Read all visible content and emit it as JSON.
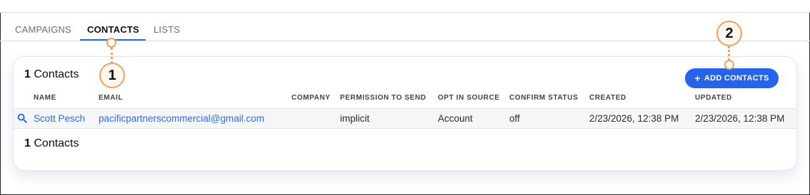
{
  "tabs": [
    {
      "label": "CAMPAIGNS",
      "active": false
    },
    {
      "label": "CONTACTS",
      "active": true
    },
    {
      "label": "LISTS",
      "active": false
    }
  ],
  "card": {
    "top_count": {
      "number": "1",
      "label": "Contacts"
    },
    "bottom_count": {
      "number": "1",
      "label": "Contacts"
    },
    "add_button": {
      "label": "ADD CONTACTS",
      "icon": "plus-icon"
    }
  },
  "table": {
    "columns": [
      "NAME",
      "EMAIL",
      "COMPANY",
      "PERMISSION TO SEND",
      "OPT IN SOURCE",
      "CONFIRM STATUS",
      "CREATED",
      "UPDATED"
    ],
    "rows": [
      {
        "name": "Scott Pesch",
        "email": "pacificpartnerscommercial@gmail.com",
        "company": "",
        "permission": "implicit",
        "opt_in_source": "Account",
        "confirm_status": "off",
        "created": "2/23/2026, 12:38 PM",
        "updated": "2/23/2026, 12:38 PM"
      }
    ]
  },
  "callouts": {
    "first": "1",
    "second": "2"
  },
  "colors": {
    "accent": "#2563eb",
    "callout": "#f2a05d",
    "link": "#2f6fe4"
  }
}
